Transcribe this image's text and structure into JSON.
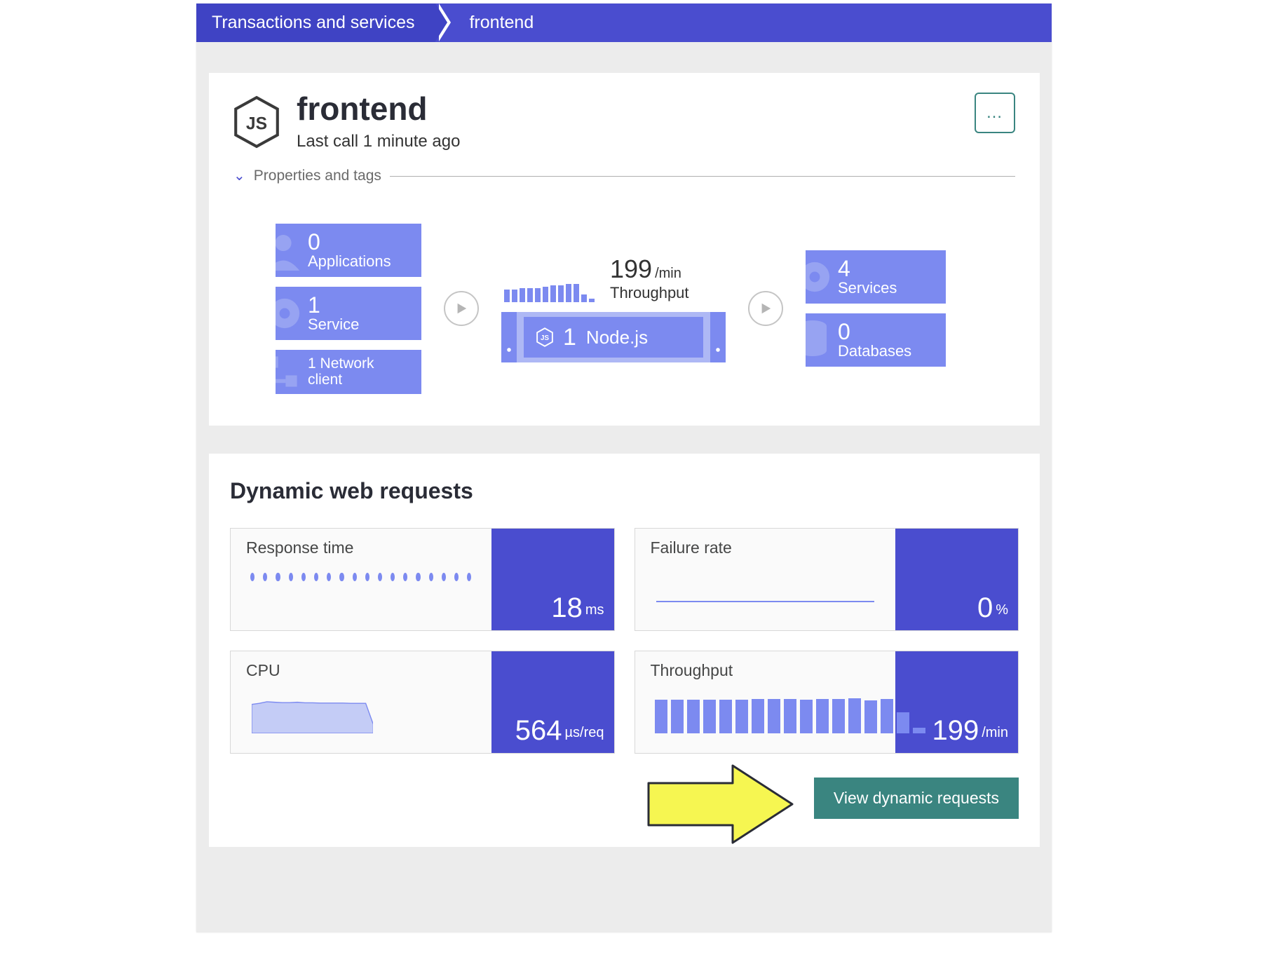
{
  "breadcrumb": {
    "home": "Transactions and services",
    "current": "frontend"
  },
  "header": {
    "title": "frontend",
    "subtitle": "Last call 1 minute ago",
    "props_toggle": "Properties and tags",
    "menu_dots": "…"
  },
  "flow": {
    "left": [
      {
        "value": "0",
        "label": "Applications"
      },
      {
        "value": "1",
        "label": "Service"
      },
      {
        "value": "1",
        "label": "Network client"
      }
    ],
    "center": {
      "throughput_value": "199",
      "throughput_unit": "/min",
      "throughput_label": "Throughput",
      "proc_count": "1",
      "proc_name": "Node.js"
    },
    "right": [
      {
        "value": "4",
        "label": "Services"
      },
      {
        "value": "0",
        "label": "Databases"
      }
    ]
  },
  "dynamic": {
    "title": "Dynamic web requests",
    "metrics": [
      {
        "name": "Response time",
        "value": "18",
        "unit": "ms"
      },
      {
        "name": "Failure rate",
        "value": "0",
        "unit": "%"
      },
      {
        "name": "CPU",
        "value": "564",
        "unit": "µs/req"
      },
      {
        "name": "Throughput",
        "value": "199",
        "unit": "/min"
      }
    ],
    "view_button": "View dynamic requests"
  },
  "chart_data": [
    {
      "type": "bar",
      "title": "Throughput mini (header)",
      "values": [
        20,
        20,
        22,
        22,
        22,
        24,
        26,
        26,
        28,
        28,
        12,
        6
      ]
    },
    {
      "type": "line",
      "title": "Response time",
      "values": [
        18,
        18,
        18,
        18,
        18,
        18,
        18,
        18,
        18,
        18,
        18,
        18,
        18,
        18,
        18,
        18,
        18,
        18
      ],
      "ylabel": "ms"
    },
    {
      "type": "line",
      "title": "Failure rate",
      "values": [
        0,
        0,
        0,
        0,
        0,
        0,
        0,
        0,
        0,
        0,
        0,
        0,
        0,
        0,
        0,
        0
      ],
      "ylabel": "%",
      "ylim": [
        0,
        100
      ]
    },
    {
      "type": "area",
      "title": "CPU",
      "values": [
        540,
        560,
        590,
        580,
        575,
        575,
        580,
        570,
        570,
        565,
        565,
        565,
        565,
        560,
        560,
        560,
        170
      ],
      "ylabel": "µs/req"
    },
    {
      "type": "bar",
      "title": "Throughput",
      "values": [
        195,
        195,
        195,
        195,
        195,
        195,
        200,
        200,
        200,
        196,
        200,
        200,
        205,
        192,
        200,
        120,
        30
      ],
      "ylabel": "/min"
    }
  ]
}
